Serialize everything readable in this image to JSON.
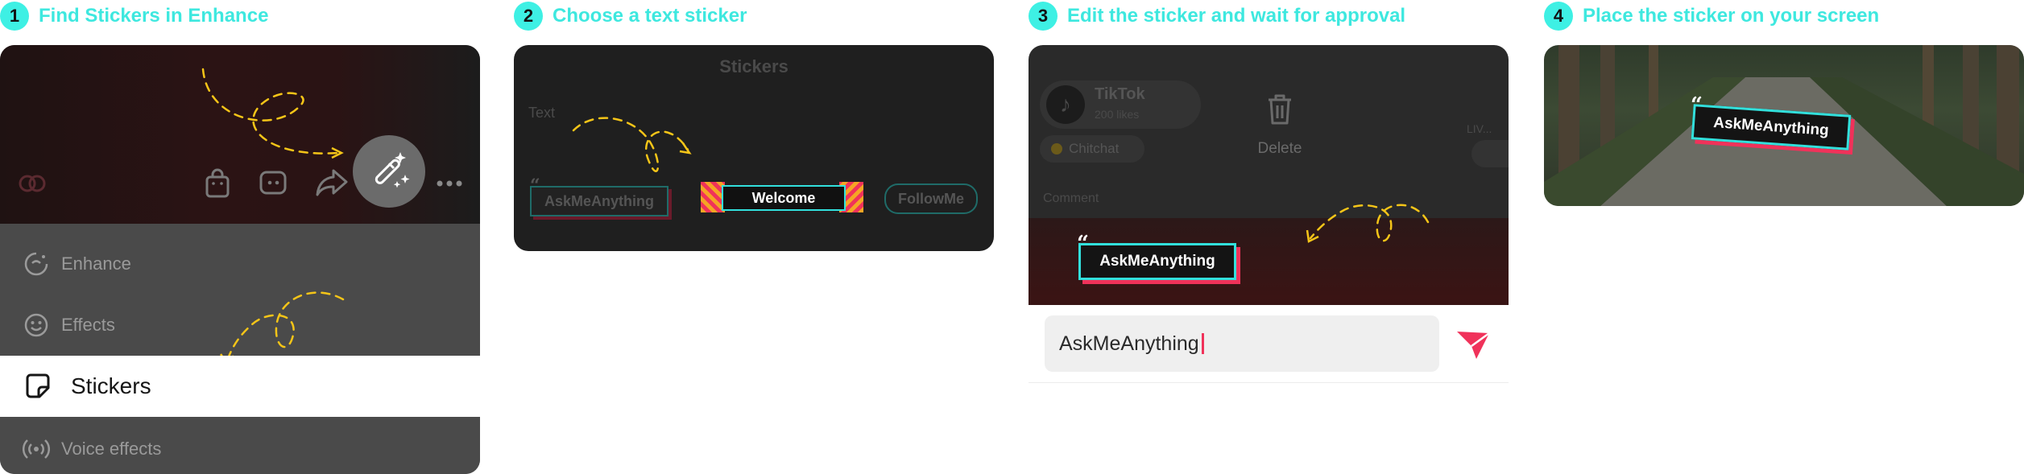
{
  "steps": [
    {
      "num": "1",
      "title": "Find Stickers in Enhance"
    },
    {
      "num": "2",
      "title": "Choose a text sticker"
    },
    {
      "num": "3",
      "title": "Edit the sticker and wait for approval"
    },
    {
      "num": "4",
      "title": "Place the sticker on your screen"
    }
  ],
  "step1": {
    "menu": {
      "enhance": "Enhance",
      "effects": "Effects",
      "stickers": "Stickers",
      "voice_effects": "Voice effects"
    }
  },
  "step2": {
    "header": "Stickers",
    "section": "Text",
    "sticker_ask": "AskMeAnything",
    "sticker_welcome": "Welcome",
    "sticker_follow": "FollowMe"
  },
  "step3": {
    "account_name": "TikTok",
    "likes": "200 likes",
    "chip": "Chitchat",
    "delete": "Delete",
    "live": "LIV...",
    "comment": "Comment",
    "sticker": "AskMeAnything",
    "input_value": "AskMeAnything"
  },
  "step4": {
    "sticker": "AskMeAnything"
  },
  "colors": {
    "accent": "#3EF0E4",
    "sticker_border": "#32E0DC",
    "sticker_shadow": "#F0325A",
    "dash": "#F5C518",
    "send": "#F0325A"
  }
}
